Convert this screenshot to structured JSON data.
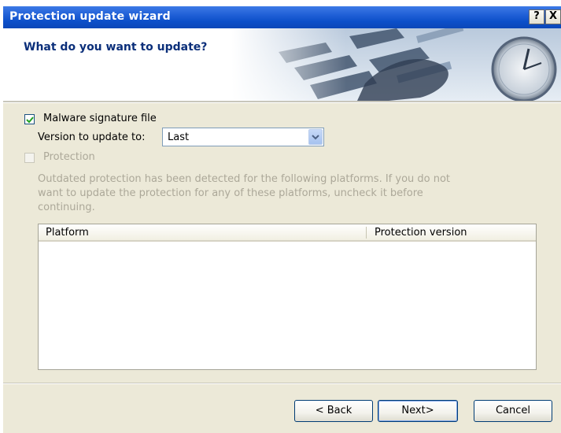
{
  "window": {
    "title": "Protection update wizard",
    "help_label": "?",
    "close_label": "X"
  },
  "header": {
    "title": "What do you want to update?"
  },
  "malware": {
    "label": "Malware signature file",
    "checked": true,
    "version_label": "Version to update to:",
    "version_value": "Last"
  },
  "protection": {
    "label": "Protection",
    "checked": false,
    "enabled": false,
    "description": "Outdated protection has been detected for the following platforms. If you do not want to update the protection for any of these platforms, uncheck it before continuing."
  },
  "table": {
    "columns": [
      "Platform",
      "Protection version"
    ],
    "rows": []
  },
  "buttons": {
    "back": "< Back",
    "next": "Next>",
    "cancel": "Cancel"
  },
  "colors": {
    "titlebar": "#0c4fc9",
    "header_title": "#0b2f7a",
    "disabled_text": "#aca899",
    "dialog_bg": "#ece9d8"
  }
}
